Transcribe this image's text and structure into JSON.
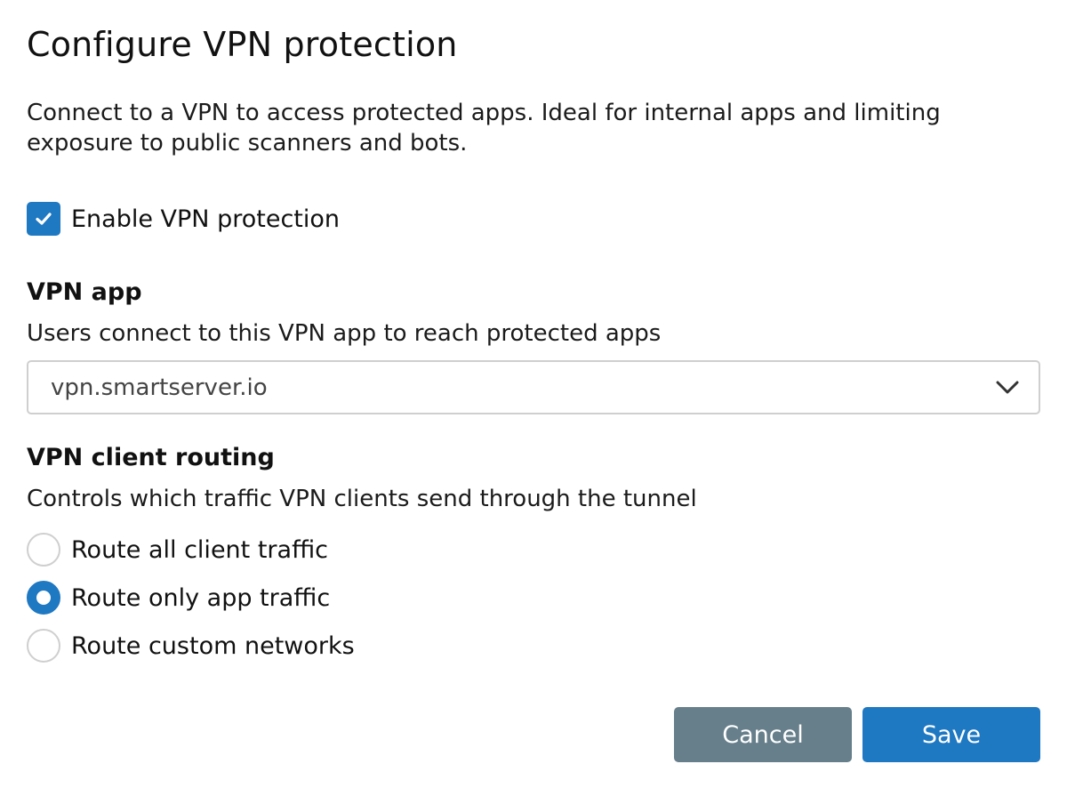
{
  "dialog": {
    "title": "Configure VPN protection",
    "description": "Connect to a VPN to access protected apps. Ideal for internal apps and limiting exposure to public scanners and bots."
  },
  "enable_vpn": {
    "label": "Enable VPN protection",
    "checked": true
  },
  "vpn_app": {
    "heading": "VPN app",
    "subheading": "Users connect to this VPN app to reach protected apps",
    "selected_value": "vpn.smartserver.io"
  },
  "routing": {
    "heading": "VPN client routing",
    "subheading": "Controls which traffic VPN clients send through the tunnel",
    "options": [
      {
        "label": "Route all client traffic",
        "selected": false
      },
      {
        "label": "Route only app traffic",
        "selected": true
      },
      {
        "label": "Route custom networks",
        "selected": false
      }
    ]
  },
  "actions": {
    "cancel_label": "Cancel",
    "save_label": "Save"
  },
  "colors": {
    "accent": "#1e78c2",
    "cancel_button": "#667f8b",
    "border": "#cfcfcf"
  },
  "icons": {
    "checkbox": "check-icon",
    "select": "chevron-down-icon"
  }
}
